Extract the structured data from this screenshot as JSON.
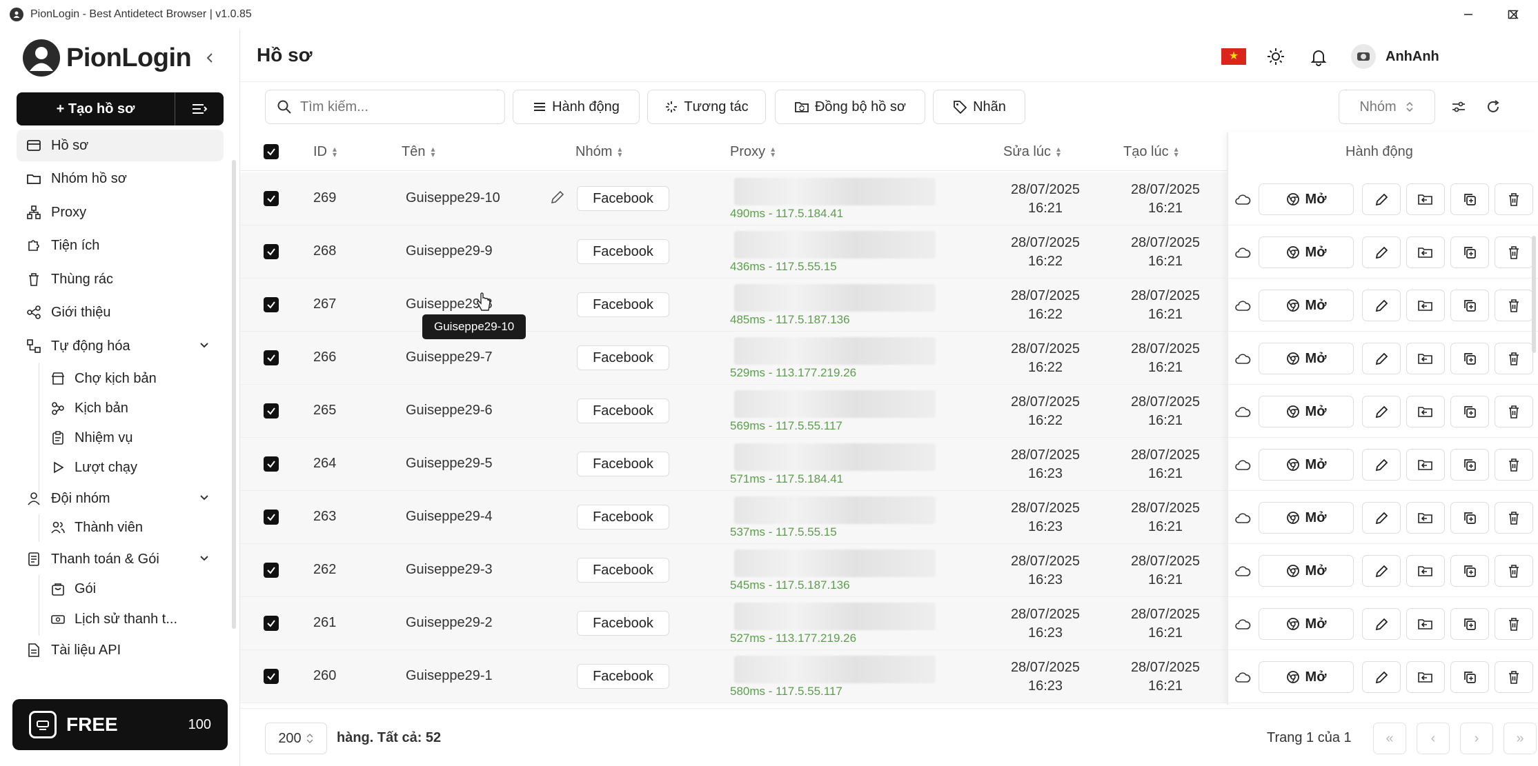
{
  "window": {
    "title": "PionLogin - Best Antidetect Browser | v1.0.85"
  },
  "brand": {
    "name": "PionLogin"
  },
  "sidebar": {
    "create_label": "+ Tạo hồ sơ",
    "nav": [
      {
        "label": "Hồ sơ",
        "icon": "id-card-icon"
      },
      {
        "label": "Nhóm hồ sơ",
        "icon": "folder-icon"
      },
      {
        "label": "Proxy",
        "icon": "network-icon"
      },
      {
        "label": "Tiện ích",
        "icon": "puzzle-icon"
      },
      {
        "label": "Thùng rác",
        "icon": "trash-icon"
      },
      {
        "label": "Giới thiệu",
        "icon": "share-icon"
      },
      {
        "label": "Tự động hóa",
        "icon": "automation-icon"
      },
      {
        "label": "Đội nhóm",
        "icon": "user-icon"
      },
      {
        "label": "Thanh toán & Gói",
        "icon": "billing-icon"
      },
      {
        "label": "Tài liệu API",
        "icon": "doc-icon"
      }
    ],
    "automation_sub": [
      {
        "label": "Chợ kịch bản"
      },
      {
        "label": "Kịch bản"
      },
      {
        "label": "Nhiệm vụ"
      },
      {
        "label": "Lượt chạy"
      }
    ],
    "team_sub": [
      {
        "label": "Thành viên"
      }
    ],
    "billing_sub": [
      {
        "label": "Gói"
      },
      {
        "label": "Lịch sử thanh t..."
      }
    ],
    "plan": {
      "name": "FREE",
      "count": "100"
    }
  },
  "header": {
    "title": "Hồ sơ",
    "username": "AnhAnh",
    "flag_star": "★"
  },
  "toolbar": {
    "search_placeholder": "Tìm kiếm...",
    "actions": "Hành động",
    "interact": "Tương tác",
    "sync": "Đồng bộ hồ sơ",
    "tags": "Nhãn",
    "group_filter": "Nhóm"
  },
  "table": {
    "columns": {
      "id": "ID",
      "name": "Tên",
      "group": "Nhóm",
      "proxy": "Proxy",
      "modified": "Sửa lúc",
      "created": "Tạo lúc",
      "actions": "Hành động"
    },
    "open_label": "Mở",
    "rows": [
      {
        "id": "269",
        "name": "Guiseppe29-10",
        "group": "Facebook",
        "ping": "490ms - 117.5.184.41",
        "modified_date": "28/07/2025",
        "modified_time": "16:21",
        "created_date": "28/07/2025",
        "created_time": "16:21"
      },
      {
        "id": "268",
        "name": "Guiseppe29-9",
        "group": "Facebook",
        "ping": "436ms - 117.5.55.15",
        "modified_date": "28/07/2025",
        "modified_time": "16:22",
        "created_date": "28/07/2025",
        "created_time": "16:21"
      },
      {
        "id": "267",
        "name": "Guiseppe29-8",
        "group": "Facebook",
        "ping": "485ms - 117.5.187.136",
        "modified_date": "28/07/2025",
        "modified_time": "16:22",
        "created_date": "28/07/2025",
        "created_time": "16:21"
      },
      {
        "id": "266",
        "name": "Guiseppe29-7",
        "group": "Facebook",
        "ping": "529ms - 113.177.219.26",
        "modified_date": "28/07/2025",
        "modified_time": "16:22",
        "created_date": "28/07/2025",
        "created_time": "16:21"
      },
      {
        "id": "265",
        "name": "Guiseppe29-6",
        "group": "Facebook",
        "ping": "569ms - 117.5.55.117",
        "modified_date": "28/07/2025",
        "modified_time": "16:22",
        "created_date": "28/07/2025",
        "created_time": "16:21"
      },
      {
        "id": "264",
        "name": "Guiseppe29-5",
        "group": "Facebook",
        "ping": "571ms - 117.5.184.41",
        "modified_date": "28/07/2025",
        "modified_time": "16:23",
        "created_date": "28/07/2025",
        "created_time": "16:21"
      },
      {
        "id": "263",
        "name": "Guiseppe29-4",
        "group": "Facebook",
        "ping": "537ms - 117.5.55.15",
        "modified_date": "28/07/2025",
        "modified_time": "16:23",
        "created_date": "28/07/2025",
        "created_time": "16:21"
      },
      {
        "id": "262",
        "name": "Guiseppe29-3",
        "group": "Facebook",
        "ping": "545ms - 117.5.187.136",
        "modified_date": "28/07/2025",
        "modified_time": "16:23",
        "created_date": "28/07/2025",
        "created_time": "16:21"
      },
      {
        "id": "261",
        "name": "Guiseppe29-2",
        "group": "Facebook",
        "ping": "527ms - 113.177.219.26",
        "modified_date": "28/07/2025",
        "modified_time": "16:23",
        "created_date": "28/07/2025",
        "created_time": "16:21"
      },
      {
        "id": "260",
        "name": "Guiseppe29-1",
        "group": "Facebook",
        "ping": "580ms - 117.5.55.117",
        "modified_date": "28/07/2025",
        "modified_time": "16:23",
        "created_date": "28/07/2025",
        "created_time": "16:21"
      }
    ],
    "tooltip": "Guiseppe29-10"
  },
  "footer": {
    "page_size": "200",
    "rows_info": "hàng. Tất cả: 52",
    "page_info": "Trang 1 của 1"
  },
  "colors": {
    "accent": "#111111",
    "ping": "#5b9e4b",
    "flag_red": "#da251d"
  }
}
